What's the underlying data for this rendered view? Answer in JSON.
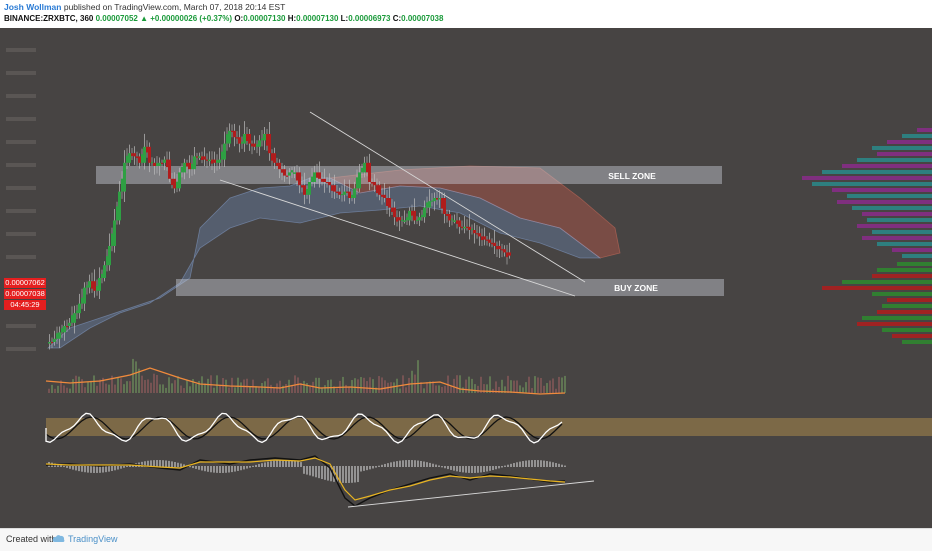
{
  "header": {
    "author": "Josh Wollman",
    "published_text": "published on TradingView.com, March 07, 2018 20:14 EST",
    "symbol": "BINANCE:ZRXBTC, 360",
    "last": "0.00007052",
    "change": "+0.00000026 (+0.37%)",
    "open_label": "O:",
    "open": "0.00007130",
    "high_label": "H:",
    "high": "0.00007130",
    "low_label": "L:",
    "low": "0.00006973",
    "close_label": "C:",
    "close": "0.00007038"
  },
  "zones": {
    "sell": "SELL ZONE",
    "buy": "BUY ZONE"
  },
  "price_scale": {
    "price1": "0.00007062",
    "price2": "0.00007038",
    "countdown": "04:45:29"
  },
  "footer": {
    "created_with": "Created with",
    "brand": "TradingView"
  },
  "colors": {
    "background": "#474443",
    "bull": "#2ea043",
    "bear": "#b01c1c",
    "cloud_bull": "#6f8fbf",
    "cloud_bear": "#c46a5a",
    "zone": "#c8ccd6",
    "rsi_band": "#a8894a",
    "macd_signal": "#e8b422",
    "ema": "#f08a3c"
  },
  "chart_data": {
    "type": "candlestick",
    "symbol": "BINANCE:ZRXBTC",
    "interval": "360",
    "x": [
      0,
      5,
      10,
      15,
      20,
      25,
      30,
      35,
      40,
      45,
      50,
      55,
      60,
      65,
      70,
      75,
      80,
      85,
      90,
      95,
      100,
      105,
      110,
      115,
      120,
      125,
      130,
      135,
      140,
      145,
      150,
      155,
      160,
      165,
      170,
      175,
      180,
      185,
      190,
      195,
      200,
      205,
      210,
      215,
      220,
      225,
      230,
      235,
      240,
      245,
      250,
      255,
      260,
      265,
      270,
      275,
      280,
      285,
      290,
      295,
      300,
      305,
      310,
      315,
      320,
      325,
      330,
      335,
      340,
      345,
      350,
      355,
      360,
      365,
      370,
      375,
      380,
      385,
      390,
      395,
      400,
      405,
      410,
      415,
      420,
      425,
      430,
      435,
      440,
      445,
      450,
      455,
      460,
      465,
      470,
      475,
      480,
      485,
      490,
      495,
      500,
      505,
      510,
      515,
      520
    ],
    "close": [
      0.3,
      0.31,
      0.33,
      0.35,
      0.36,
      0.39,
      0.42,
      0.47,
      0.49,
      0.46,
      0.5,
      0.54,
      0.6,
      0.68,
      0.77,
      0.86,
      0.89,
      0.88,
      0.86,
      0.91,
      0.86,
      0.85,
      0.86,
      0.87,
      0.81,
      0.78,
      0.83,
      0.86,
      0.84,
      0.88,
      0.88,
      0.87,
      0.87,
      0.86,
      0.87,
      0.92,
      0.96,
      0.94,
      0.92,
      0.95,
      0.92,
      0.91,
      0.93,
      0.95,
      0.89,
      0.86,
      0.84,
      0.82,
      0.83,
      0.83,
      0.79,
      0.76,
      0.8,
      0.83,
      0.81,
      0.8,
      0.79,
      0.77,
      0.76,
      0.77,
      0.75,
      0.78,
      0.83,
      0.86,
      0.8,
      0.79,
      0.76,
      0.75,
      0.72,
      0.69,
      0.68,
      0.68,
      0.71,
      0.68,
      0.69,
      0.72,
      0.74,
      0.75,
      0.75,
      0.7,
      0.68,
      0.68,
      0.66,
      0.66,
      0.65,
      0.64,
      0.63,
      0.62,
      0.61,
      0.6,
      0.59,
      0.58,
      0.57
    ],
    "bands": {
      "rsi_zone": "shaded band",
      "zones": [
        "SELL ZONE",
        "BUY ZONE"
      ]
    },
    "title": "",
    "xlabel": "",
    "ylabel": ""
  }
}
